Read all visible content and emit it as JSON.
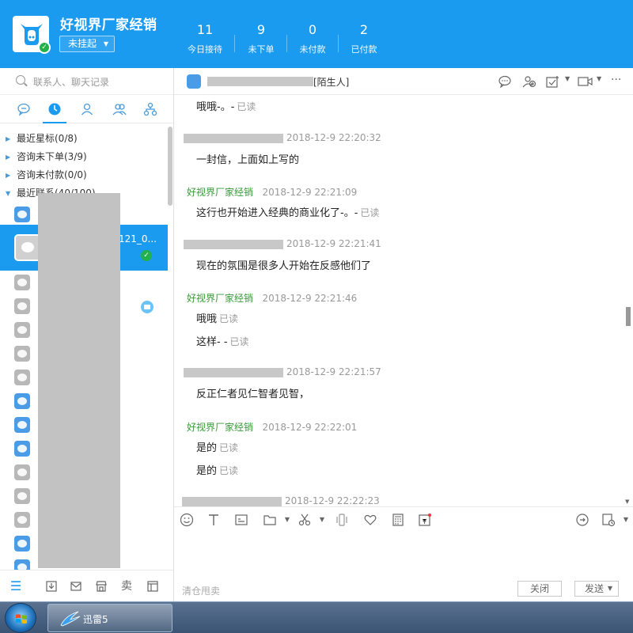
{
  "header": {
    "shop_name": "好视界厂家经销",
    "status": "未挂起",
    "stats": [
      {
        "value": "11",
        "label": "今日接待"
      },
      {
        "value": "9",
        "label": "未下单"
      },
      {
        "value": "0",
        "label": "未付款"
      },
      {
        "value": "2",
        "label": "已付款"
      }
    ]
  },
  "sidebar": {
    "search_placeholder": "联系人、聊天记录",
    "groups": [
      "最近星标(0/8)",
      "咨询未下单(3/9)",
      "咨询未付款(0/0)",
      "最近联系(40/100)"
    ],
    "selected_contact": "121_0..."
  },
  "chat": {
    "stranger_tag": "[陌生人]",
    "read_label": "已读",
    "messages": [
      {
        "sender": "",
        "time": "",
        "lines": [
          {
            "text": "哦哦-。-",
            "read": true
          }
        ]
      },
      {
        "sender": "",
        "time": "2018-12-9 22:20:32",
        "lines": [
          {
            "text": "一封信，上面如上写的",
            "read": false
          }
        ]
      },
      {
        "sender": "好视界厂家经销",
        "time": "2018-12-9 22:21:09",
        "lines": [
          {
            "text": "这行也开始进入经典的商业化了-。-",
            "read": true
          }
        ]
      },
      {
        "sender": "",
        "time": "2018-12-9 22:21:41",
        "lines": [
          {
            "text": "现在的氛围是很多人开始在反感他们了",
            "read": false
          }
        ]
      },
      {
        "sender": "好视界厂家经销",
        "time": "2018-12-9 22:21:46",
        "lines": [
          {
            "text": "哦哦",
            "read": true
          },
          {
            "text": "这样- -",
            "read": true
          }
        ]
      },
      {
        "sender": "",
        "time": "2018-12-9 22:21:57",
        "lines": [
          {
            "text": "反正仁者见仁智者见智，",
            "read": false
          }
        ]
      },
      {
        "sender": "好视界厂家经销",
        "time": "2018-12-9 22:22:01",
        "lines": [
          {
            "text": "是的",
            "read": true
          },
          {
            "text": "是的",
            "read": true
          }
        ]
      },
      {
        "sender": "",
        "time": "2018-12-9 22:22:23",
        "lines": []
      }
    ]
  },
  "input": {
    "placeholder": "清仓甩卖",
    "close_label": "关闭",
    "send_label": "发送"
  },
  "taskbar": {
    "item_label": "迅雷5"
  },
  "colors": {
    "accent": "#1a9bf0",
    "sender_green": "#3a9a3a"
  }
}
